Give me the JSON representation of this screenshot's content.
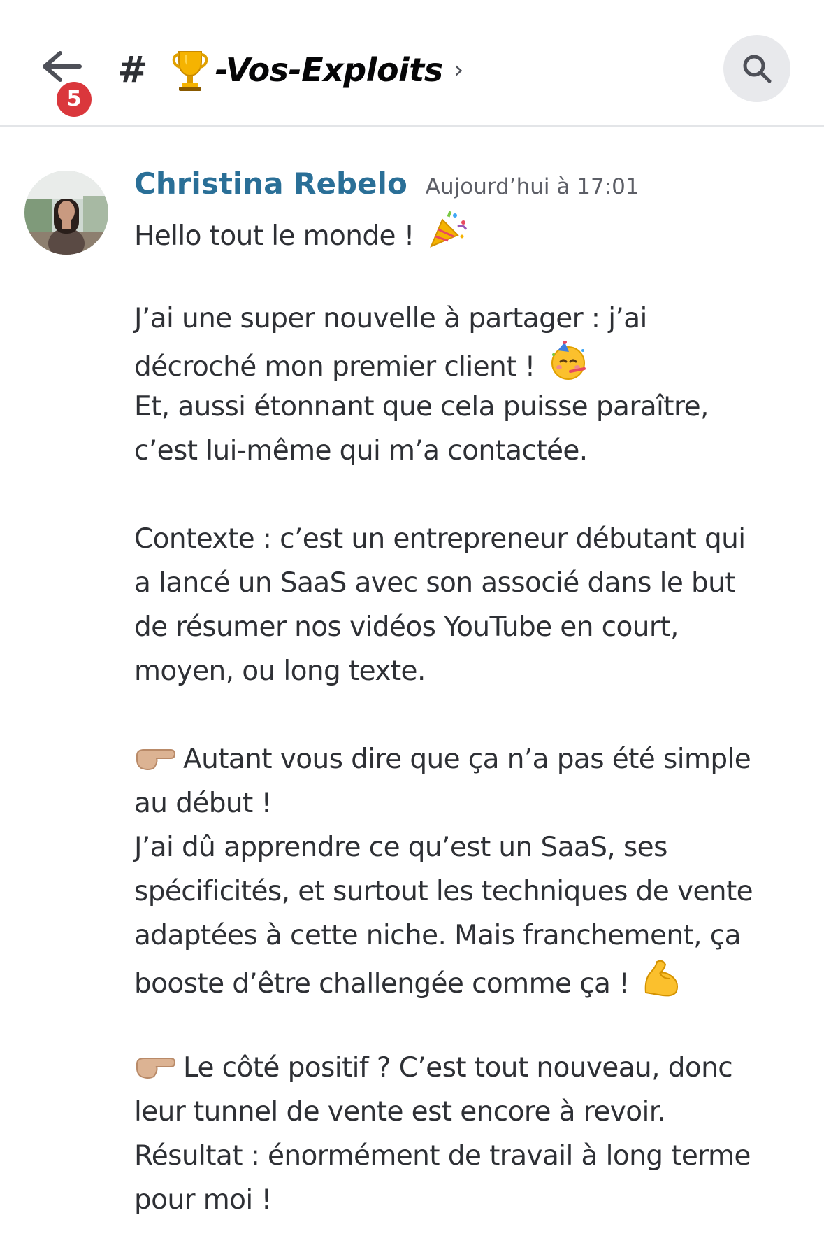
{
  "header": {
    "back_badge": "5",
    "hash": "#",
    "channel_name": "-Vos-Exploits",
    "chevron": "›"
  },
  "message": {
    "author": "Christina Rebelo",
    "timestamp": "Aujourd’hui à 17:01",
    "author_color": "#2a6f97",
    "lines": {
      "l1": "Hello tout le monde !",
      "l2": "J’ai une super nouvelle à partager : j’ai",
      "l3": "décroché mon premier client !",
      "l4": "Et, aussi étonnant que cela puisse paraître,",
      "l5": "c’est lui-même qui m’a contactée.",
      "l6": "Contexte : c’est un entrepreneur débutant qui",
      "l7": "a lancé un SaaS avec son associé dans le but",
      "l8": "de résumer nos vidéos YouTube en court,",
      "l9": "moyen, ou long texte.",
      "l10": "Autant vous dire que ça n’a pas été simple",
      "l11": "au début !",
      "l12": "J’ai dû apprendre ce qu’est un SaaS, ses",
      "l13": "spécificités, et surtout les techniques de vente",
      "l14": "adaptées à cette niche. Mais franchement, ça",
      "l15": "booste d’être challengée comme ça !",
      "l16": "Le côté positif ? C’est tout nouveau, donc",
      "l17": "leur tunnel de vente est encore à revoir.",
      "l18": "Résultat : énormément de travail à long terme",
      "l19": "pour moi !"
    }
  }
}
